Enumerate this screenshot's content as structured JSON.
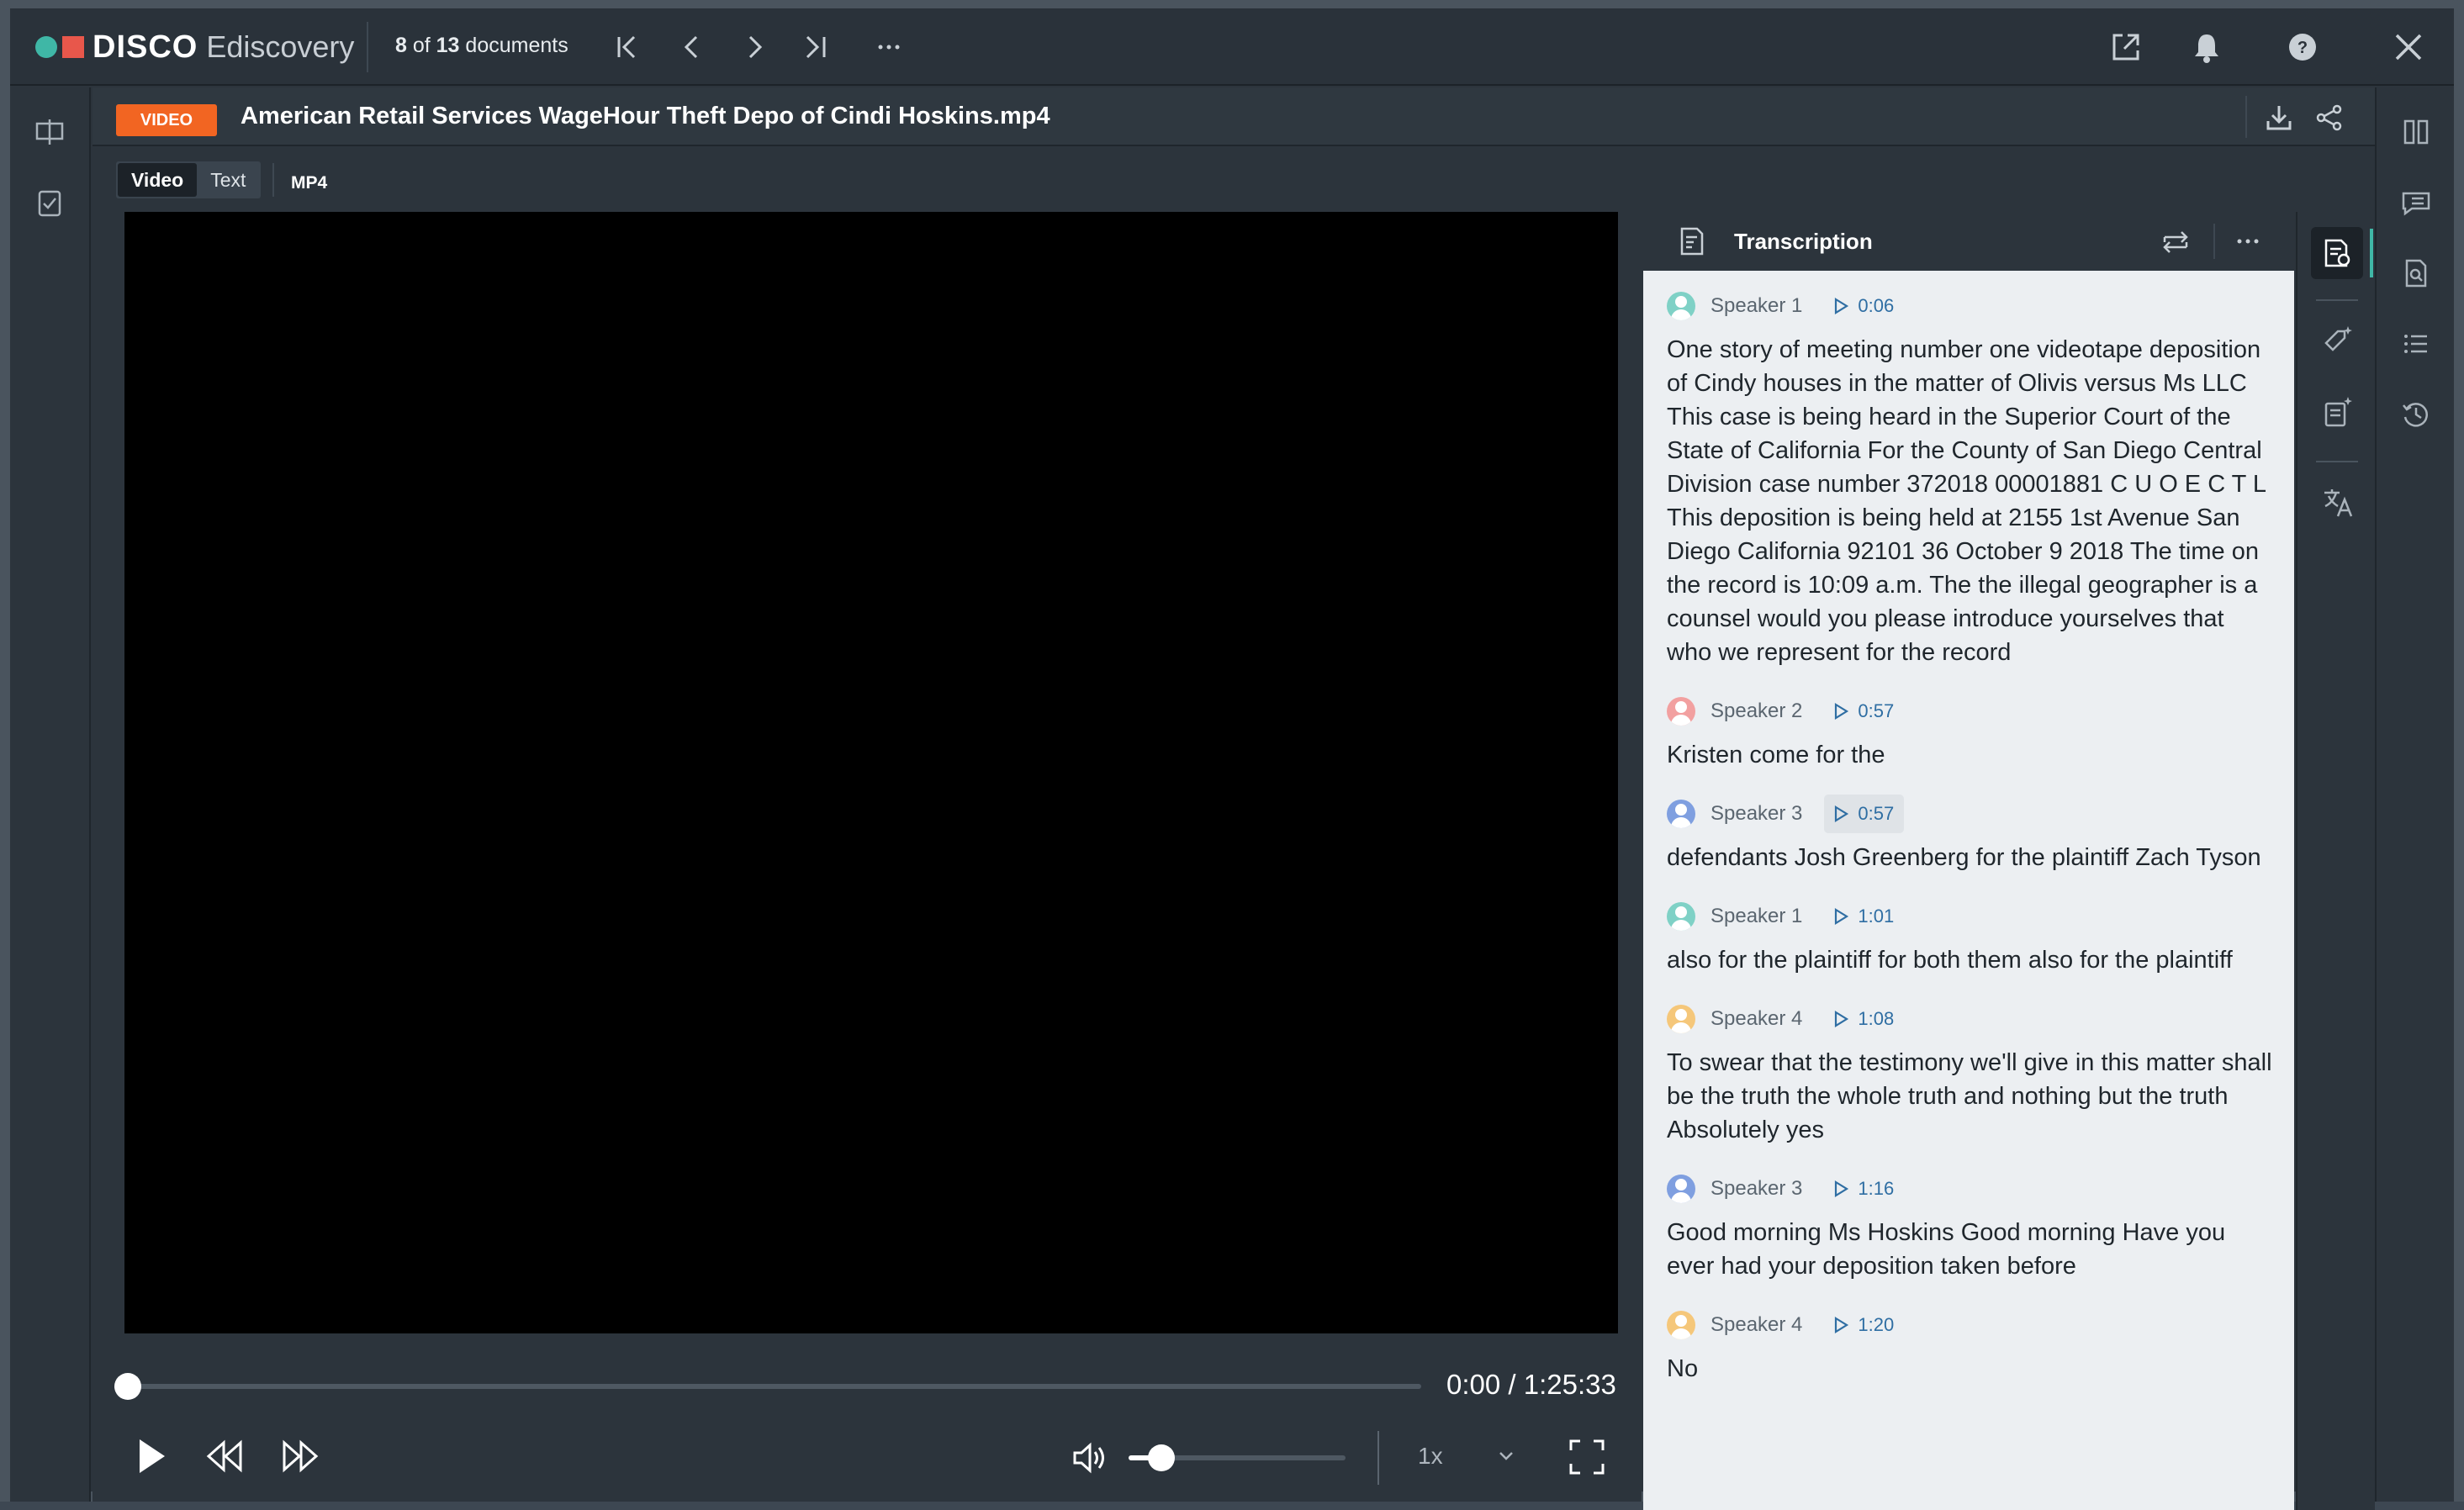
{
  "app": {
    "brand": "DISCO",
    "product": "Ediscovery"
  },
  "topbar": {
    "doc_current": "8",
    "doc_of": " of ",
    "doc_total": "13",
    "doc_suffix": " documents"
  },
  "icons": {
    "first": "first-page-icon",
    "prev": "chevron-left-icon",
    "next": "chevron-right-icon",
    "last": "last-page-icon",
    "more": "more-icon",
    "popout": "pop-out-icon",
    "bell": "notification-bell-icon",
    "help": "help-icon",
    "close": "close-icon"
  },
  "document": {
    "type_badge": "VIDEO",
    "title": "American Retail Services WageHour Theft Depo of Cindi Hoskins.mp4",
    "format": "MP4"
  },
  "tabs": [
    {
      "label": "Video",
      "active": true
    },
    {
      "label": "Text",
      "active": false
    }
  ],
  "player": {
    "current": "0:00",
    "separator": " / ",
    "duration": "1:25:33",
    "progress": 0,
    "volume": 0.15,
    "speed": "1x"
  },
  "transcript": {
    "title": "Transcription",
    "entries": [
      {
        "speaker": "Speaker 1",
        "time": "0:06",
        "color": "#7fd1c6",
        "highlighted": false,
        "text": "One story of meeting number one videotape deposition of Cindy houses in the matter of Olivis versus Ms LLC This case is being heard in the Superior Court of the State of California For the County of San Diego Central Division case number 372018 00001881 C U O E C T L This deposition is being held at 2155 1st Avenue San Diego California 92101 36 October 9 2018 The time on the record is 10:09 a.m. The the illegal geographer is a counsel would you please introduce yourselves that who we represent for the record"
      },
      {
        "speaker": "Speaker 2",
        "time": "0:57",
        "color": "#f2a0a0",
        "highlighted": false,
        "text": "Kristen come for the"
      },
      {
        "speaker": "Speaker 3",
        "time": "0:57",
        "color": "#7f9fe0",
        "highlighted": true,
        "text": "defendants Josh Greenberg for the plaintiff Zach Tyson"
      },
      {
        "speaker": "Speaker 1",
        "time": "1:01",
        "color": "#7fd1c6",
        "highlighted": false,
        "text": "also for the plaintiff for both them also for the plaintiff"
      },
      {
        "speaker": "Speaker 4",
        "time": "1:08",
        "color": "#f5c77a",
        "highlighted": false,
        "text": "To swear that the testimony we'll give in this matter shall be the truth the whole truth and nothing but the truth Absolutely yes"
      },
      {
        "speaker": "Speaker 3",
        "time": "1:16",
        "color": "#7f9fe0",
        "highlighted": false,
        "text": "Good morning Ms Hoskins Good morning Have you ever had your deposition taken before"
      },
      {
        "speaker": "Speaker 4",
        "time": "1:20",
        "color": "#f5c77a",
        "highlighted": false,
        "text": "No"
      }
    ]
  }
}
